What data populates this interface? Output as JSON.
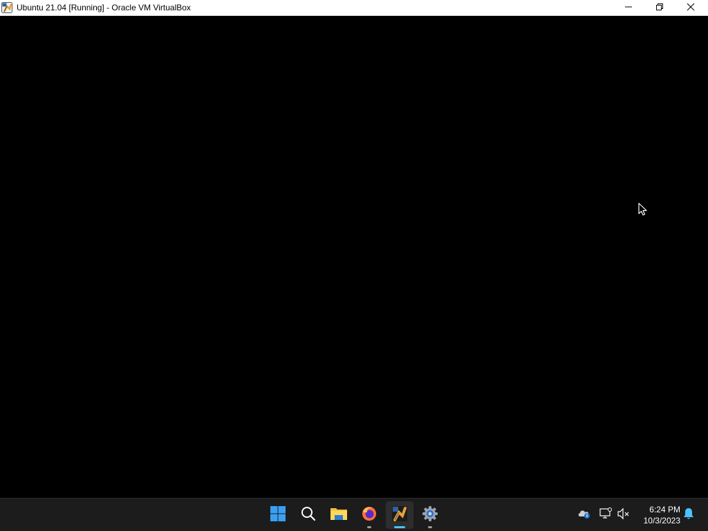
{
  "window": {
    "title": "Ubuntu 21.04 [Running] - Oracle VM VirtualBox",
    "app_icon": "virtualbox-icon",
    "controls": {
      "minimize_icon": "minimize-icon",
      "restore_icon": "restore-icon",
      "close_icon": "close-icon"
    }
  },
  "vm_screen": {
    "background": "#000000",
    "cursor_icon": "mouse-pointer-icon"
  },
  "taskbar": {
    "pinned": [
      {
        "name": "start",
        "icon": "windows-start-icon"
      },
      {
        "name": "search",
        "icon": "search-icon"
      },
      {
        "name": "file-explorer",
        "icon": "folder-icon"
      },
      {
        "name": "firefox",
        "icon": "firefox-icon",
        "running": true
      },
      {
        "name": "virtualbox",
        "icon": "virtualbox-icon",
        "running": true,
        "active": true
      },
      {
        "name": "settings",
        "icon": "settings-gear-icon",
        "running": true
      }
    ],
    "tray": {
      "onedrive_icon": "cloud-icon",
      "network_icon": "network-icon",
      "volume_icon": "volume-muted-icon",
      "time": "6:24 PM",
      "date": "10/3/2023",
      "notification_icon": "bell-icon"
    },
    "accent_color": "#4cc2ff"
  }
}
